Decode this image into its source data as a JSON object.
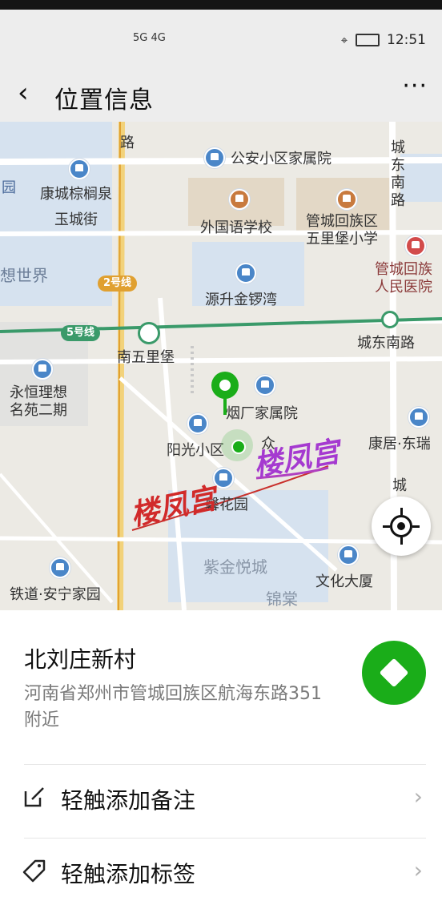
{
  "status_bar": {
    "network": "5G 4G",
    "time": "12:51"
  },
  "header": {
    "back_icon": "‹",
    "title": "位置信息",
    "more_icon": "···"
  },
  "map": {
    "labels": {
      "lu": "路",
      "gongan": "公安小区家属院",
      "chengdongnanlu_v": "城\n东\n南\n路",
      "kangcheng": "康城棕榈泉",
      "yuan": "园",
      "yuchengjie": "玉城街",
      "waiguoyu": "外国语学校",
      "wulibao_school": "管城回族区\n五里堡小学",
      "xiangshijie": "想世界",
      "hospital": "管城回族\n人民医院",
      "yuansheng": "源升金锣湾",
      "nanwulibao": "南五里堡",
      "chengdongnanlu": "城东南路",
      "yongheng": "永恒理想\n名苑二期",
      "yanchang": "烟厂家属院",
      "yangguang": "阳光小区",
      "zhong": "众",
      "kangju": "康居·东瑞",
      "cheng": "城",
      "xinhua": "馨花园",
      "zijin": "紫金悦城",
      "wenhua": "文化大厦",
      "tiedao": "铁道·安宁家园",
      "jintang": "锦棠"
    },
    "metro_tags": {
      "line2": "2号线",
      "line5": "5号线"
    },
    "stamp_text": "楼凤宫"
  },
  "place": {
    "name": "北刘庄新村",
    "address": "河南省郑州市管城回族区航海东路351附近"
  },
  "actions": [
    {
      "icon": "edit-icon",
      "label": "轻触添加备注"
    },
    {
      "icon": "tag-icon",
      "label": "轻触添加标签"
    }
  ],
  "colors": {
    "accent": "#1aad19",
    "marker": "#1aad19",
    "line5": "#3a9a6a",
    "line2": "#e0a030"
  }
}
